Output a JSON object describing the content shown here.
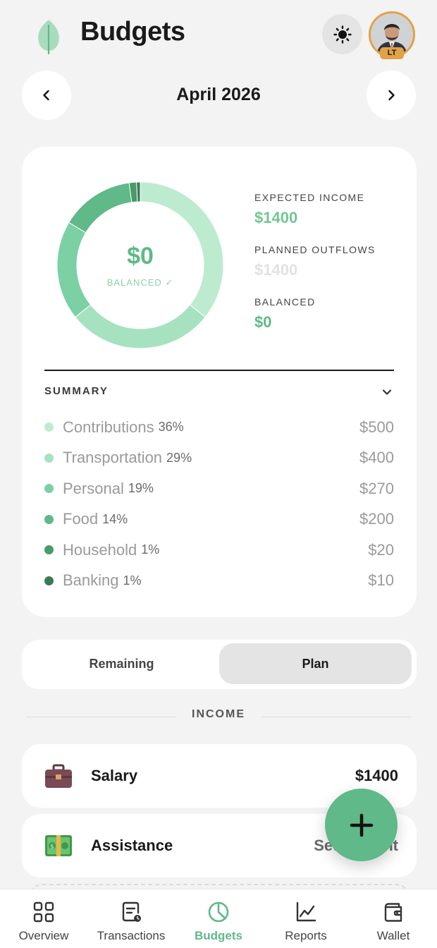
{
  "header": {
    "title": "Budgets",
    "avatar_initials": "LT"
  },
  "month_nav": {
    "label": "April 2026"
  },
  "summary": {
    "donut_value": "$0",
    "donut_caption": "BALANCED ✓",
    "stats": [
      {
        "label": "EXPECTED INCOME",
        "value": "$1400"
      },
      {
        "label": "PLANNED OUTFLOWS",
        "value": "$1400"
      },
      {
        "label": "BALANCED",
        "value": "$0"
      }
    ],
    "section_title": "SUMMARY",
    "categories": [
      {
        "name": "Contributions",
        "pct": "36%",
        "amount": "$500",
        "color": "#bdebd0"
      },
      {
        "name": "Transportation",
        "pct": "29%",
        "amount": "$400",
        "color": "#a6e2c0"
      },
      {
        "name": "Personal",
        "pct": "19%",
        "amount": "$270",
        "color": "#7bd0a4"
      },
      {
        "name": "Food",
        "pct": "14%",
        "amount": "$200",
        "color": "#5fb988"
      },
      {
        "name": "Household",
        "pct": "1%",
        "amount": "$20",
        "color": "#4a9a6c"
      },
      {
        "name": "Banking",
        "pct": "1%",
        "amount": "$10",
        "color": "#3c7a55"
      }
    ]
  },
  "donut_segments": [
    {
      "value": 500,
      "color": "#bdebd0"
    },
    {
      "value": 400,
      "color": "#a6e2c0"
    },
    {
      "value": 270,
      "color": "#7bd0a4"
    },
    {
      "value": 200,
      "color": "#5fb988"
    },
    {
      "value": 20,
      "color": "#4a9a6c"
    },
    {
      "value": 10,
      "color": "#3c7a55"
    }
  ],
  "view_toggle": {
    "options": [
      "Remaining",
      "Plan"
    ],
    "selected": "Plan"
  },
  "income": {
    "title": "INCOME",
    "items": [
      {
        "name": "Salary",
        "amount": "$1400",
        "icon": "briefcase-icon"
      },
      {
        "name": "Assistance",
        "amount": "Set amount",
        "icon": "banknote-icon"
      }
    ]
  },
  "bottom_nav": {
    "items": [
      {
        "label": "Overview",
        "icon": "grid-icon"
      },
      {
        "label": "Transactions",
        "icon": "receipt-icon"
      },
      {
        "label": "Budgets",
        "icon": "pie-chart-icon"
      },
      {
        "label": "Reports",
        "icon": "line-chart-icon"
      },
      {
        "label": "Wallet",
        "icon": "wallet-icon"
      }
    ],
    "active": "Budgets"
  },
  "colors": {
    "accent": "#5fb988",
    "background": "#f3f3f3",
    "card": "#ffffff",
    "avatar_ring": "#e3a244"
  }
}
